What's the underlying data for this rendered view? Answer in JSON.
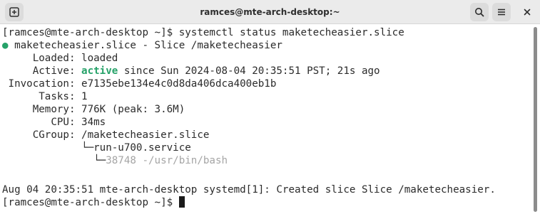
{
  "window": {
    "title": "ramces@mte-arch-desktop:~"
  },
  "headerbar": {
    "icons": {
      "new_tab": "new-tab-icon",
      "search": "search-icon",
      "menu": "hamburger-menu-icon",
      "close": "close-icon"
    }
  },
  "terminal": {
    "lines": [
      "[ramces@mte-arch-desktop ~]$ systemctl status maketecheasier.slice",
      " maketecheasier.slice - Slice /maketecheasier",
      "     Loaded: loaded",
      "     Active: ",
      " since Sun 2024-08-04 20:35:51 PST; 21s ago",
      " Invocation: e7135ebe134e4c0d8da406dca400eb1b",
      "      Tasks: 1",
      "     Memory: 776K (peak: 3.6M)",
      "        CPU: 34ms",
      "     CGroup: /maketecheasier.slice",
      "             └─run-u700.service",
      "               └─",
      "38748 -/usr/bin/bash",
      "",
      "Aug 04 20:35:51 mte-arch-desktop systemd[1]: Created slice Slice /maketecheasier.",
      "[ramces@mte-arch-desktop ~]$ "
    ],
    "bullet": "●",
    "active_state": "active"
  },
  "colors": {
    "accent_green": "#26a269",
    "dim_text": "#a5a5a5",
    "text": "#2b2b2b",
    "headerbar_bg": "#ebebeb"
  }
}
